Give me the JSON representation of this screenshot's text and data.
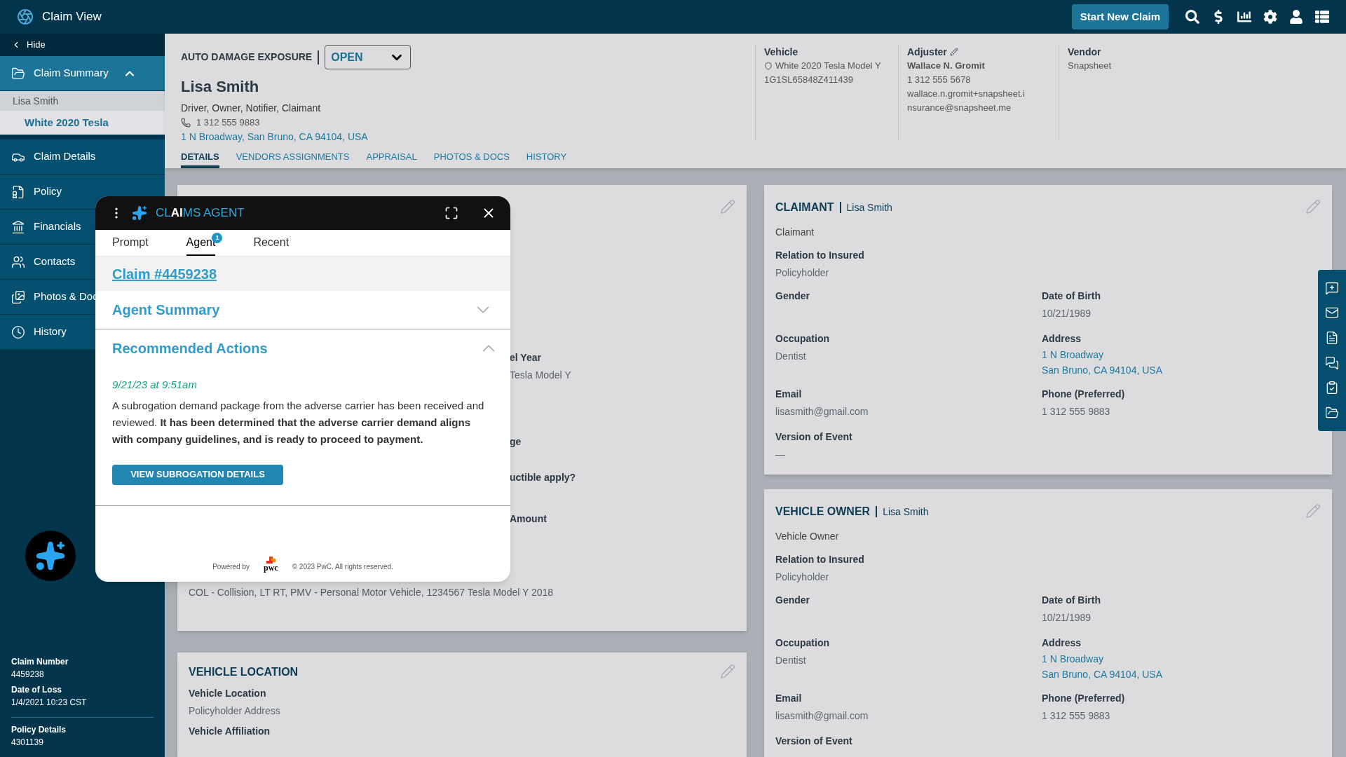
{
  "app": {
    "title": "Claim View",
    "primary_action": "Start New Claim"
  },
  "sidebar": {
    "hide": "Hide",
    "items": [
      {
        "label": "Claim Summary",
        "selected": true,
        "expanded": true,
        "children": [
          {
            "label": "Lisa Smith",
            "selected": false
          },
          {
            "label": "White 2020 Tesla",
            "selected": true
          }
        ]
      },
      {
        "label": "Claim Details",
        "selected": false
      },
      {
        "label": "Policy",
        "selected": false
      },
      {
        "label": "Financials",
        "selected": false
      },
      {
        "label": "Contacts",
        "selected": false
      },
      {
        "label": "Photos & Doc",
        "selected": false
      },
      {
        "label": "History",
        "selected": false
      }
    ],
    "claim_info": [
      {
        "label": "Claim Number",
        "value": "4459238"
      },
      {
        "label": "Date of Loss",
        "value": "1/4/2021 10:23 CST"
      }
    ],
    "policy_info": {
      "label": "Policy Details",
      "value": "4301139"
    }
  },
  "header": {
    "exposure": "AUTO DAMAGE EXPOSURE",
    "status": "OPEN",
    "name": "Lisa Smith",
    "roles": "Driver, Owner, Notifier, Claimant",
    "phone": "1 312 555 9883",
    "address": "1 N Broadway, San Bruno, CA 94104, USA",
    "columns": [
      {
        "title": "Vehicle",
        "lines": [
          "White 2020 Tesla Model Y",
          "1G1SL65848Z411439"
        ]
      },
      {
        "title": "Adjuster",
        "name": "Wallace N. Gromit",
        "lines": [
          "1 312 555 5678",
          "wallace.n.gromit+snapsheet.i",
          "nsurance@snapsheet.me"
        ]
      },
      {
        "title": "Vendor",
        "lines": [
          "Snapsheet"
        ]
      }
    ],
    "tabs": [
      {
        "label": "DETAILS",
        "selected": true
      },
      {
        "label": "VENDORS ASSIGNMENTS",
        "selected": false
      },
      {
        "label": "APPRAISAL",
        "selected": false
      },
      {
        "label": "PHOTOS & DOCS",
        "selected": false
      },
      {
        "label": "HISTORY",
        "selected": false
      }
    ]
  },
  "details_card": {
    "fields": [
      {
        "label": "el Year",
        "value": "Tesla Model Y"
      },
      {
        "label": "ge"
      },
      {
        "label": "uctible apply?"
      },
      {
        "label": "Amount"
      }
    ],
    "coverage": "COL - Collision, LT RT, PMV - Personal Motor Vehicle, 1234567 Tesla Model Y 2018"
  },
  "location_card": {
    "title": "VEHICLE LOCATION",
    "fields": [
      {
        "label": "Vehicle Location",
        "value": "Policyholder Address"
      },
      {
        "label": "Vehicle Affiliation"
      }
    ]
  },
  "person_cards": [
    {
      "title": "CLAIMANT",
      "subtitle": "Lisa Smith",
      "role": "Claimant",
      "relation": {
        "label": "Relation to Insured",
        "value": "Policyholder"
      },
      "fields": [
        {
          "label": "Gender",
          "kind": "text"
        },
        {
          "label": "Date of Birth",
          "kind": "text",
          "lines": [
            "10/21/1989"
          ]
        },
        {
          "label": "Occupation",
          "kind": "text",
          "lines": [
            "Dentist"
          ]
        },
        {
          "label": "Address",
          "kind": "link",
          "lines": [
            "1 N Broadway",
            "San Bruno, CA 94104, USA"
          ]
        },
        {
          "label": "Email",
          "kind": "text",
          "lines": [
            "lisasmith@gmail.com"
          ]
        },
        {
          "label": "Phone (Preferred)",
          "kind": "text",
          "lines": [
            "1 312 555 9883"
          ]
        },
        {
          "label": "Version of Event",
          "kind": "text",
          "lines": [
            "—"
          ]
        }
      ]
    },
    {
      "title": "VEHICLE OWNER",
      "subtitle": "Lisa Smith",
      "role": "Vehicle Owner",
      "relation": {
        "label": "Relation to Insured",
        "value": "Policyholder"
      },
      "fields": [
        {
          "label": "Gender",
          "kind": "text"
        },
        {
          "label": "Date of Birth",
          "kind": "text",
          "lines": [
            "10/21/1989"
          ]
        },
        {
          "label": "Occupation",
          "kind": "text",
          "lines": [
            "Dentist"
          ]
        },
        {
          "label": "Address",
          "kind": "link",
          "lines": [
            "1 N Broadway",
            "San Bruno, CA 94104, USA"
          ]
        },
        {
          "label": "Email",
          "kind": "text",
          "lines": [
            "lisasmith@gmail.com"
          ]
        },
        {
          "label": "Phone (Preferred)",
          "kind": "text",
          "lines": [
            "1 312 555 9883"
          ]
        },
        {
          "label": "Version of Event",
          "kind": "text"
        }
      ]
    }
  ],
  "agent": {
    "title": "CL**AI**MS AGENT",
    "tabs": [
      {
        "label": "Prompt",
        "selected": false
      },
      {
        "label": "Agent",
        "selected": true,
        "badge": "1"
      },
      {
        "label": "Recent",
        "selected": false
      }
    ],
    "claim_link": "Claim #4459238",
    "sections": [
      {
        "title": "Agent Summary",
        "expanded": false
      },
      {
        "title": "Recommended Actions",
        "expanded": true,
        "timestamp": "9/21/23 at 9:51am",
        "message": "A subrogation demand package from the adverse carrier has been received and reviewed. **It has been determined that the adverse carrier demand aligns with company guidelines, and is ready to proceed to payment.**",
        "action": "VIEW SUBROGATION DETAILS"
      }
    ],
    "footer": {
      "powered_by": "Powered by",
      "logo": "pwc",
      "copyright": "© 2023 PwC. All rights reserved."
    }
  }
}
